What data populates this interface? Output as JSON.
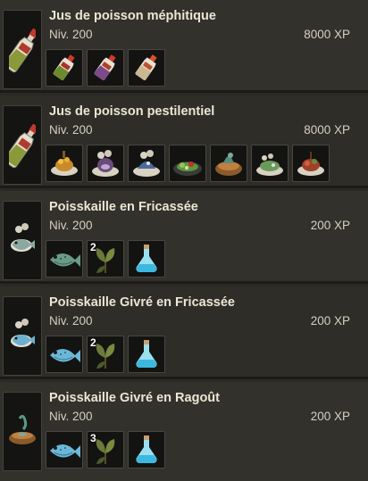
{
  "recipes": [
    {
      "name": "Jus de poisson méphitique",
      "level": "Niv. 200",
      "xp": "8000 XP",
      "result_icon": "potion-bottle-icon",
      "ingredients": [
        {
          "icon": "potion-bottle-icon",
          "qty": ""
        },
        {
          "icon": "potion-bottle-icon",
          "qty": ""
        },
        {
          "icon": "potion-bottle-icon",
          "qty": ""
        }
      ]
    },
    {
      "name": "Jus de poisson pestilentiel",
      "level": "Niv. 200",
      "xp": "8000 XP",
      "result_icon": "potion-bottle-icon",
      "ingredients": [
        {
          "icon": "fish-dish-icon",
          "qty": ""
        },
        {
          "icon": "fish-dish-icon",
          "qty": ""
        },
        {
          "icon": "fish-dish-icon",
          "qty": ""
        },
        {
          "icon": "fish-dish-icon",
          "qty": ""
        },
        {
          "icon": "fish-dish-icon",
          "qty": ""
        },
        {
          "icon": "fish-dish-icon",
          "qty": ""
        },
        {
          "icon": "fish-dish-icon",
          "qty": ""
        }
      ]
    },
    {
      "name": "Poisskaille en Fricassée",
      "level": "Niv. 200",
      "xp": "200 XP",
      "result_icon": "fish-dish-icon",
      "ingredients": [
        {
          "icon": "raw-fish-icon",
          "qty": ""
        },
        {
          "icon": "herb-leaves-icon",
          "qty": "2"
        },
        {
          "icon": "blue-potion-icon",
          "qty": ""
        }
      ]
    },
    {
      "name": "Poisskaille Givré en Fricassée",
      "level": "Niv. 200",
      "xp": "200 XP",
      "result_icon": "fish-dish-icon",
      "ingredients": [
        {
          "icon": "raw-fish-icon",
          "qty": ""
        },
        {
          "icon": "herb-leaves-icon",
          "qty": "2"
        },
        {
          "icon": "blue-potion-icon",
          "qty": ""
        }
      ]
    },
    {
      "name": "Poisskaille Givré en Ragoût",
      "level": "Niv. 200",
      "xp": "200 XP",
      "result_icon": "stew-bowl-icon",
      "ingredients": [
        {
          "icon": "raw-fish-icon",
          "qty": ""
        },
        {
          "icon": "herb-leaves-icon",
          "qty": "3"
        },
        {
          "icon": "blue-potion-icon",
          "qty": ""
        }
      ]
    }
  ]
}
